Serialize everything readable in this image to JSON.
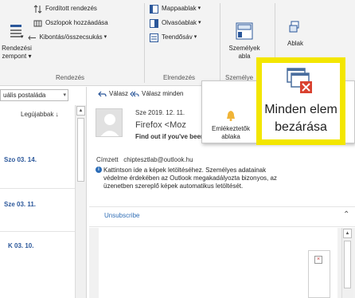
{
  "ribbon": {
    "rendezes": {
      "big_label_1": "Rendezési",
      "big_label_2": "zempont",
      "items": [
        "Fordított rendezés",
        "Oszlopok hozzáadása",
        "Kibontás/összecsukás"
      ],
      "group_label": "Rendezés"
    },
    "elrendezes": {
      "items": [
        "Mappaablak",
        "Olvasóablak",
        "Teendősáv"
      ],
      "group_label": "Elrendezés"
    },
    "szemelyek": {
      "label_1": "Személyek",
      "label_2": "abla",
      "group_label": "Személye"
    },
    "ablak": {
      "label": "Ablak"
    }
  },
  "mail_list": {
    "folder_select": "uális postaláda",
    "column_header": "Legújabbak",
    "dates": [
      "Szo 03. 14.",
      "Sze 03. 11.",
      "K 03. 10."
    ]
  },
  "reading": {
    "reply": "Válasz",
    "reply_all": "Válasz minden",
    "date": "Sze 2019. 12. 11.",
    "sender": "Firefox <Moz",
    "subject": "Find out if you've been a part",
    "to_label": "Címzett",
    "to_value": "chiptesztlab@outlook.hu",
    "info_lines": [
      "Kattintson ide a képek letöltéséhez. Személyes adatainak",
      "védelme érdekében az Outlook megakadályozta bizonyos, az",
      "üzenetben szereplő képek automatikus letöltését."
    ],
    "unsubscribe": "Unsubscribe"
  },
  "ablak_menu": {
    "reminder_label_1": "Emlékeztetők",
    "reminder_label_2": "ablaka",
    "close_all_line_1": "Minden elem",
    "close_all_line_2": "bezárása"
  },
  "colors": {
    "highlight": "#f3e600",
    "accent": "#2b579a",
    "close_red": "#d9412f"
  }
}
